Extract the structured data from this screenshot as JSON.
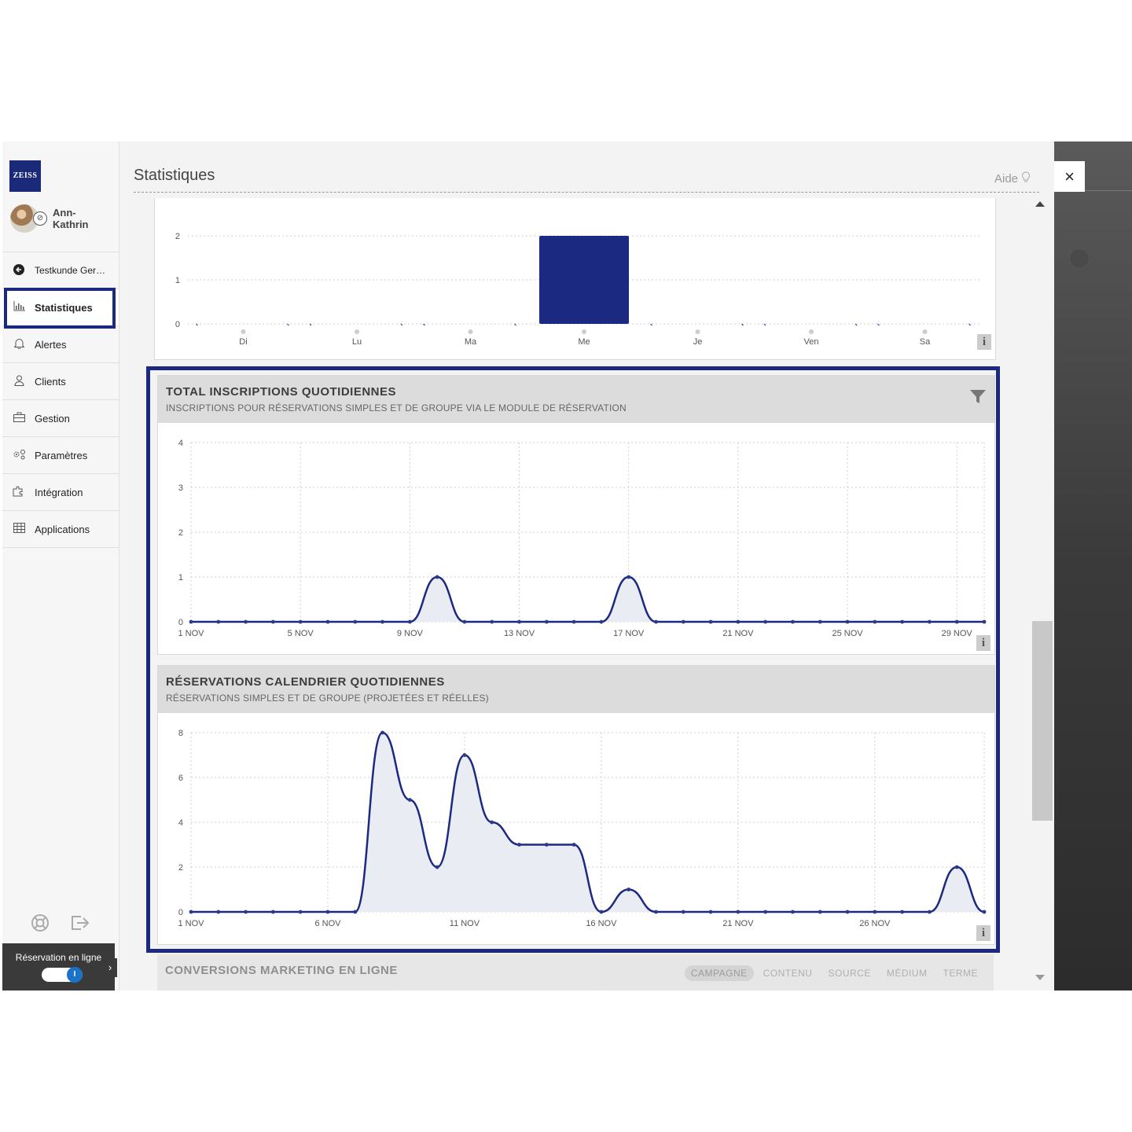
{
  "app": {
    "logo_text": "ZEISS",
    "user_name": "Ann-Kathrin",
    "page_title": "Statistiques",
    "help_label": "Aide",
    "close_label": "×"
  },
  "sidebar": {
    "items": [
      {
        "label": "Testkunde Ger…",
        "icon": "arrow-left-circle-icon"
      },
      {
        "label": "Statistiques",
        "icon": "bar-chart-icon",
        "active": true
      },
      {
        "label": "Alertes",
        "icon": "bell-icon"
      },
      {
        "label": "Clients",
        "icon": "user-icon"
      },
      {
        "label": "Gestion",
        "icon": "briefcase-icon"
      },
      {
        "label": "Paramètres",
        "icon": "gears-icon"
      },
      {
        "label": "Intégration",
        "icon": "puzzle-icon"
      },
      {
        "label": "Applications",
        "icon": "grid-icon"
      }
    ],
    "online_label": "Réservation en ligne",
    "toggle_knob": "I",
    "toggle_on": true
  },
  "charts": {
    "weekday": {
      "info": "i",
      "chart_data": {
        "type": "bar",
        "categories": [
          "Di",
          "Lu",
          "Ma",
          "Me",
          "Je",
          "Ven",
          "Sa"
        ],
        "values": [
          0,
          0,
          0,
          2,
          0,
          0,
          0
        ],
        "yticks": [
          0,
          1,
          2
        ],
        "ylim": [
          0,
          2
        ]
      }
    },
    "inscriptions": {
      "title": "TOTAL INSCRIPTIONS QUOTIDIENNES",
      "subtitle": "INSCRIPTIONS POUR RÉSERVATIONS SIMPLES ET DE GROUPE VIA LE MODULE DE RÉSERVATION",
      "info": "i",
      "chart_data": {
        "type": "area",
        "x_tick_labels": [
          "1 NOV",
          "5 NOV",
          "9 NOV",
          "13 NOV",
          "17 NOV",
          "21 NOV",
          "25 NOV",
          "29 NOV"
        ],
        "x_tick_days": [
          1,
          5,
          9,
          13,
          17,
          21,
          25,
          29
        ],
        "yticks": [
          0,
          1,
          2,
          3,
          4
        ],
        "ylim": [
          0,
          4
        ],
        "x": [
          1,
          2,
          3,
          4,
          5,
          6,
          7,
          8,
          9,
          10,
          11,
          12,
          13,
          14,
          15,
          16,
          17,
          18,
          19,
          20,
          21,
          22,
          23,
          24,
          25,
          26,
          27,
          28,
          29,
          30
        ],
        "values": [
          0,
          0,
          0,
          0,
          0,
          0,
          0,
          0,
          0,
          1,
          0,
          0,
          0,
          0,
          0,
          0,
          1,
          0,
          0,
          0,
          0,
          0,
          0,
          0,
          0,
          0,
          0,
          0,
          0,
          0
        ]
      }
    },
    "reservations": {
      "title": "RÉSERVATIONS CALENDRIER QUOTIDIENNES",
      "subtitle": "RÉSERVATIONS SIMPLES ET DE GROUPE (PROJETÉES ET RÉELLES)",
      "info": "i",
      "chart_data": {
        "type": "area",
        "x_tick_labels": [
          "1 NOV",
          "6 NOV",
          "11 NOV",
          "16 NOV",
          "21 NOV",
          "26 NOV"
        ],
        "x_tick_days": [
          1,
          6,
          11,
          16,
          21,
          26
        ],
        "yticks": [
          0,
          2,
          4,
          6,
          8
        ],
        "ylim": [
          0,
          8
        ],
        "x": [
          1,
          2,
          3,
          4,
          5,
          6,
          7,
          8,
          9,
          10,
          11,
          12,
          13,
          14,
          15,
          16,
          17,
          18,
          19,
          20,
          21,
          22,
          23,
          24,
          25,
          26,
          27,
          28,
          29,
          30
        ],
        "values": [
          0,
          0,
          0,
          0,
          0,
          0,
          0,
          8,
          5,
          2,
          7,
          4,
          3,
          3,
          3,
          0,
          1,
          0,
          0,
          0,
          0,
          0,
          0,
          0,
          0,
          0,
          0,
          0,
          2,
          0
        ]
      }
    },
    "conversions": {
      "title": "CONVERSIONS MARKETING EN LIGNE",
      "tabs": [
        "CAMPAGNE",
        "CONTENU",
        "SOURCE",
        "MÉDIUM",
        "TERME"
      ],
      "selected_tab": "CAMPAGNE"
    }
  },
  "colors": {
    "series": "#1b2a80",
    "area_fill": "#e9ecf3",
    "highlight": "#1b2a80",
    "grid": "#cfcfcf"
  }
}
